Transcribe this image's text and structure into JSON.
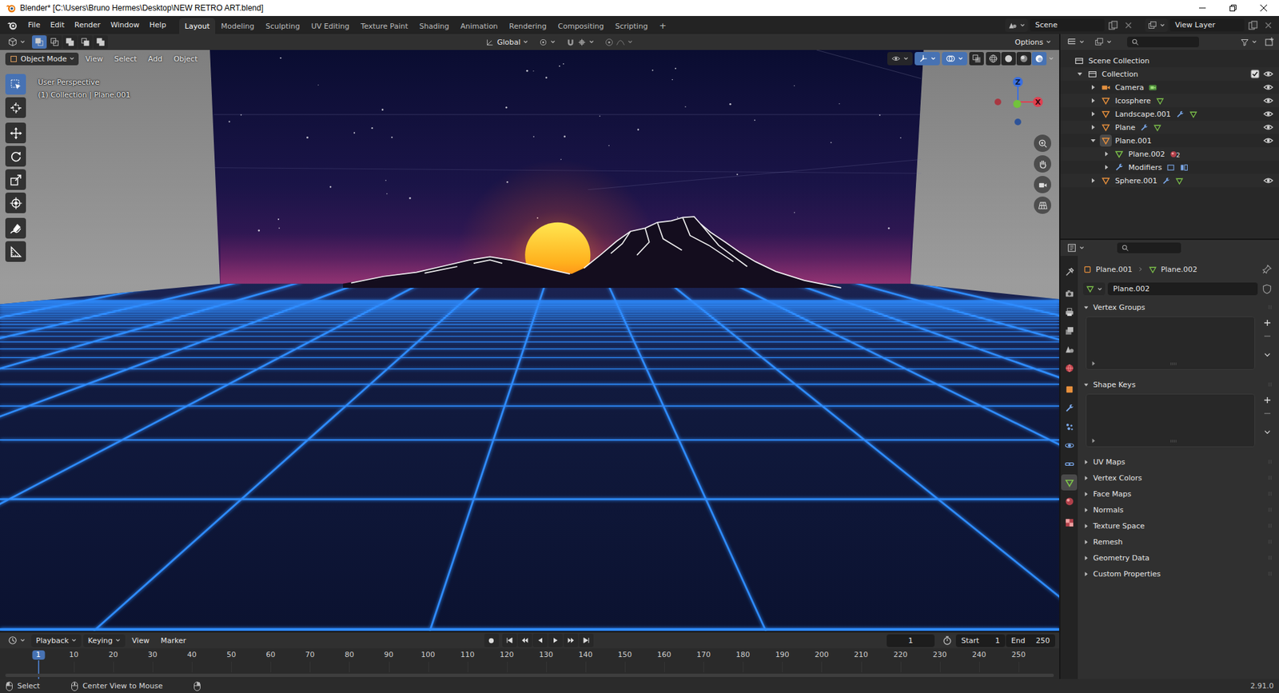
{
  "window": {
    "title": "Blender* [C:\\Users\\Bruno Hermes\\Desktop\\NEW RETRO ART.blend]"
  },
  "menu": [
    "File",
    "Edit",
    "Render",
    "Window",
    "Help"
  ],
  "workspaces": [
    {
      "label": "Layout",
      "selected": true
    },
    {
      "label": "Modeling",
      "selected": false
    },
    {
      "label": "Sculpting",
      "selected": false
    },
    {
      "label": "UV Editing",
      "selected": false
    },
    {
      "label": "Texture Paint",
      "selected": false
    },
    {
      "label": "Shading",
      "selected": false
    },
    {
      "label": "Animation",
      "selected": false
    },
    {
      "label": "Rendering",
      "selected": false
    },
    {
      "label": "Compositing",
      "selected": false
    },
    {
      "label": "Scripting",
      "selected": false
    }
  ],
  "add_workspace": "+",
  "scene": "Scene",
  "view_layer": "View Layer",
  "viewport": {
    "select_modes": [
      {
        "selected": true
      },
      {
        "selected": false
      },
      {
        "selected": false
      },
      {
        "selected": false
      },
      {
        "selected": false
      }
    ],
    "orientation": "Global",
    "options": "Options",
    "mode": "Object Mode",
    "menus": [
      "View",
      "Select",
      "Add",
      "Object"
    ],
    "info": [
      "User Perspective",
      "(1) Collection | Plane.001"
    ],
    "toggles": [
      {
        "kind": "gizmos",
        "on": true
      },
      {
        "kind": "overlays",
        "on": true
      }
    ],
    "shading": [
      {
        "kind": "wireframe",
        "selected": false
      },
      {
        "kind": "solid",
        "selected": false
      },
      {
        "kind": "material",
        "selected": false
      },
      {
        "kind": "rendered",
        "selected": true
      }
    ],
    "tool_groups": [
      [
        {
          "kind": "select-box",
          "selected": true
        },
        {
          "kind": "cursor",
          "selected": false
        }
      ],
      [
        {
          "kind": "move",
          "selected": false
        },
        {
          "kind": "rotate",
          "selected": false
        },
        {
          "kind": "scale",
          "selected": false
        },
        {
          "kind": "transform",
          "selected": false
        }
      ],
      [
        {
          "kind": "annotate",
          "selected": false
        },
        {
          "kind": "measure",
          "selected": false
        }
      ]
    ],
    "gizmo": {
      "z": "Z",
      "x": "X"
    }
  },
  "outliner": {
    "rows": [
      {
        "name": "Scene Collection",
        "depth": 0,
        "kind": "scene-collection",
        "has_arrow": false,
        "active": false,
        "extras": [],
        "eye": false
      },
      {
        "name": "Collection",
        "depth": 1,
        "kind": "collection",
        "has_arrow": true,
        "expanded": true,
        "active": false,
        "extras": [],
        "checked": true,
        "eye": true
      },
      {
        "name": "Camera",
        "depth": 2,
        "kind": "camera",
        "has_arrow": true,
        "expanded": false,
        "active": false,
        "extras": [
          {
            "kind": "camera-data"
          }
        ],
        "eye": true
      },
      {
        "name": "Icosphere",
        "depth": 2,
        "kind": "mesh-object",
        "has_arrow": true,
        "expanded": false,
        "active": false,
        "extras": [
          {
            "kind": "mesh-data"
          }
        ],
        "eye": true
      },
      {
        "name": "Landscape.001",
        "depth": 2,
        "kind": "mesh-object",
        "has_arrow": true,
        "expanded": false,
        "active": false,
        "extras": [
          {
            "kind": "modifier"
          },
          {
            "kind": "mesh-data"
          }
        ],
        "eye": true
      },
      {
        "name": "Plane",
        "depth": 2,
        "kind": "mesh-object",
        "has_arrow": true,
        "expanded": false,
        "active": false,
        "extras": [
          {
            "kind": "modifier"
          },
          {
            "kind": "mesh-data"
          }
        ],
        "eye": true
      },
      {
        "name": "Plane.001",
        "depth": 2,
        "kind": "mesh-object",
        "has_arrow": true,
        "expanded": true,
        "active": true,
        "extras": [],
        "eye": true
      },
      {
        "name": "Plane.002",
        "depth": 3,
        "kind": "mesh-data",
        "has_arrow": true,
        "expanded": false,
        "active": false,
        "extras": [
          {
            "kind": "material",
            "badge": "2"
          }
        ],
        "eye": false
      },
      {
        "name": "Modifiers",
        "depth": 3,
        "kind": "modifiers",
        "has_arrow": true,
        "expanded": false,
        "active": false,
        "extras": [
          {
            "kind": "array"
          },
          {
            "kind": "mirror"
          }
        ],
        "eye": false
      },
      {
        "name": "Sphere.001",
        "depth": 2,
        "kind": "mesh-object",
        "has_arrow": true,
        "expanded": false,
        "active": false,
        "extras": [
          {
            "kind": "modifier"
          },
          {
            "kind": "mesh-data"
          }
        ],
        "eye": true
      }
    ]
  },
  "properties": {
    "tab_groups": [
      [
        {
          "kind": "tool",
          "selected": false
        }
      ],
      [
        {
          "kind": "render",
          "selected": false
        },
        {
          "kind": "output",
          "selected": false
        },
        {
          "kind": "view-layer",
          "selected": false
        },
        {
          "kind": "scene",
          "selected": false
        },
        {
          "kind": "world",
          "selected": false
        }
      ],
      [
        {
          "kind": "object",
          "selected": false
        },
        {
          "kind": "modifiers",
          "selected": false
        },
        {
          "kind": "particles",
          "selected": false
        },
        {
          "kind": "physics",
          "selected": false
        },
        {
          "kind": "constraints",
          "selected": false
        },
        {
          "kind": "data",
          "selected": true
        },
        {
          "kind": "material",
          "selected": false
        }
      ],
      [
        {
          "kind": "texture",
          "selected": false
        }
      ]
    ],
    "breadcrumb": [
      "Plane.001",
      "Plane.002"
    ],
    "datablock": "Plane.002",
    "panels": [
      {
        "title": "Vertex Groups",
        "expanded": true
      },
      {
        "title": "Shape Keys",
        "expanded": true
      },
      {
        "title": "UV Maps",
        "expanded": false
      },
      {
        "title": "Vertex Colors",
        "expanded": false
      },
      {
        "title": "Face Maps",
        "expanded": false
      },
      {
        "title": "Normals",
        "expanded": false
      },
      {
        "title": "Texture Space",
        "expanded": false
      },
      {
        "title": "Remesh",
        "expanded": false
      },
      {
        "title": "Geometry Data",
        "expanded": false
      },
      {
        "title": "Custom Properties",
        "expanded": false
      }
    ]
  },
  "timeline": {
    "menus": [
      {
        "label": "Playback",
        "dropdown": true
      },
      {
        "label": "Keying",
        "dropdown": true
      },
      {
        "label": "View",
        "dropdown": false
      },
      {
        "label": "Marker",
        "dropdown": false
      }
    ],
    "current_frame": "1",
    "start_label": "Start",
    "start": "1",
    "end_label": "End",
    "end": "250",
    "ticks": [
      "1",
      "10",
      "20",
      "30",
      "40",
      "50",
      "60",
      "70",
      "80",
      "90",
      "100",
      "110",
      "120",
      "130",
      "140",
      "150",
      "160",
      "170",
      "180",
      "190",
      "200",
      "210",
      "220",
      "230",
      "240",
      "250"
    ]
  },
  "status_bar": {
    "hints": [
      "Select",
      "Center View to Mouse"
    ],
    "version": "2.91.0"
  }
}
